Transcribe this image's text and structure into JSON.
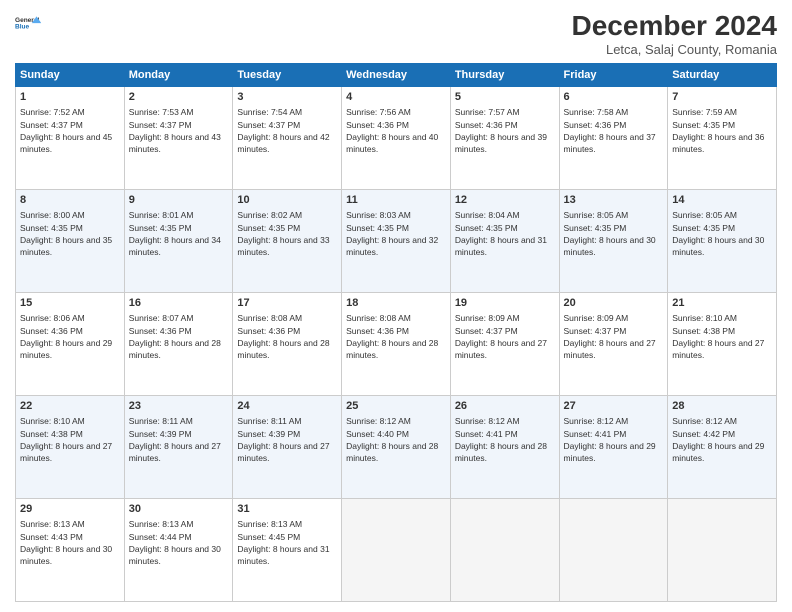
{
  "header": {
    "title": "December 2024",
    "location": "Letca, Salaj County, Romania"
  },
  "days_of_week": [
    "Sunday",
    "Monday",
    "Tuesday",
    "Wednesday",
    "Thursday",
    "Friday",
    "Saturday"
  ],
  "weeks": [
    [
      {
        "day": "1",
        "sunrise": "Sunrise: 7:52 AM",
        "sunset": "Sunset: 4:37 PM",
        "daylight": "Daylight: 8 hours and 45 minutes."
      },
      {
        "day": "2",
        "sunrise": "Sunrise: 7:53 AM",
        "sunset": "Sunset: 4:37 PM",
        "daylight": "Daylight: 8 hours and 43 minutes."
      },
      {
        "day": "3",
        "sunrise": "Sunrise: 7:54 AM",
        "sunset": "Sunset: 4:37 PM",
        "daylight": "Daylight: 8 hours and 42 minutes."
      },
      {
        "day": "4",
        "sunrise": "Sunrise: 7:56 AM",
        "sunset": "Sunset: 4:36 PM",
        "daylight": "Daylight: 8 hours and 40 minutes."
      },
      {
        "day": "5",
        "sunrise": "Sunrise: 7:57 AM",
        "sunset": "Sunset: 4:36 PM",
        "daylight": "Daylight: 8 hours and 39 minutes."
      },
      {
        "day": "6",
        "sunrise": "Sunrise: 7:58 AM",
        "sunset": "Sunset: 4:36 PM",
        "daylight": "Daylight: 8 hours and 37 minutes."
      },
      {
        "day": "7",
        "sunrise": "Sunrise: 7:59 AM",
        "sunset": "Sunset: 4:35 PM",
        "daylight": "Daylight: 8 hours and 36 minutes."
      }
    ],
    [
      {
        "day": "8",
        "sunrise": "Sunrise: 8:00 AM",
        "sunset": "Sunset: 4:35 PM",
        "daylight": "Daylight: 8 hours and 35 minutes."
      },
      {
        "day": "9",
        "sunrise": "Sunrise: 8:01 AM",
        "sunset": "Sunset: 4:35 PM",
        "daylight": "Daylight: 8 hours and 34 minutes."
      },
      {
        "day": "10",
        "sunrise": "Sunrise: 8:02 AM",
        "sunset": "Sunset: 4:35 PM",
        "daylight": "Daylight: 8 hours and 33 minutes."
      },
      {
        "day": "11",
        "sunrise": "Sunrise: 8:03 AM",
        "sunset": "Sunset: 4:35 PM",
        "daylight": "Daylight: 8 hours and 32 minutes."
      },
      {
        "day": "12",
        "sunrise": "Sunrise: 8:04 AM",
        "sunset": "Sunset: 4:35 PM",
        "daylight": "Daylight: 8 hours and 31 minutes."
      },
      {
        "day": "13",
        "sunrise": "Sunrise: 8:05 AM",
        "sunset": "Sunset: 4:35 PM",
        "daylight": "Daylight: 8 hours and 30 minutes."
      },
      {
        "day": "14",
        "sunrise": "Sunrise: 8:05 AM",
        "sunset": "Sunset: 4:35 PM",
        "daylight": "Daylight: 8 hours and 30 minutes."
      }
    ],
    [
      {
        "day": "15",
        "sunrise": "Sunrise: 8:06 AM",
        "sunset": "Sunset: 4:36 PM",
        "daylight": "Daylight: 8 hours and 29 minutes."
      },
      {
        "day": "16",
        "sunrise": "Sunrise: 8:07 AM",
        "sunset": "Sunset: 4:36 PM",
        "daylight": "Daylight: 8 hours and 28 minutes."
      },
      {
        "day": "17",
        "sunrise": "Sunrise: 8:08 AM",
        "sunset": "Sunset: 4:36 PM",
        "daylight": "Daylight: 8 hours and 28 minutes."
      },
      {
        "day": "18",
        "sunrise": "Sunrise: 8:08 AM",
        "sunset": "Sunset: 4:36 PM",
        "daylight": "Daylight: 8 hours and 28 minutes."
      },
      {
        "day": "19",
        "sunrise": "Sunrise: 8:09 AM",
        "sunset": "Sunset: 4:37 PM",
        "daylight": "Daylight: 8 hours and 27 minutes."
      },
      {
        "day": "20",
        "sunrise": "Sunrise: 8:09 AM",
        "sunset": "Sunset: 4:37 PM",
        "daylight": "Daylight: 8 hours and 27 minutes."
      },
      {
        "day": "21",
        "sunrise": "Sunrise: 8:10 AM",
        "sunset": "Sunset: 4:38 PM",
        "daylight": "Daylight: 8 hours and 27 minutes."
      }
    ],
    [
      {
        "day": "22",
        "sunrise": "Sunrise: 8:10 AM",
        "sunset": "Sunset: 4:38 PM",
        "daylight": "Daylight: 8 hours and 27 minutes."
      },
      {
        "day": "23",
        "sunrise": "Sunrise: 8:11 AM",
        "sunset": "Sunset: 4:39 PM",
        "daylight": "Daylight: 8 hours and 27 minutes."
      },
      {
        "day": "24",
        "sunrise": "Sunrise: 8:11 AM",
        "sunset": "Sunset: 4:39 PM",
        "daylight": "Daylight: 8 hours and 27 minutes."
      },
      {
        "day": "25",
        "sunrise": "Sunrise: 8:12 AM",
        "sunset": "Sunset: 4:40 PM",
        "daylight": "Daylight: 8 hours and 28 minutes."
      },
      {
        "day": "26",
        "sunrise": "Sunrise: 8:12 AM",
        "sunset": "Sunset: 4:41 PM",
        "daylight": "Daylight: 8 hours and 28 minutes."
      },
      {
        "day": "27",
        "sunrise": "Sunrise: 8:12 AM",
        "sunset": "Sunset: 4:41 PM",
        "daylight": "Daylight: 8 hours and 29 minutes."
      },
      {
        "day": "28",
        "sunrise": "Sunrise: 8:12 AM",
        "sunset": "Sunset: 4:42 PM",
        "daylight": "Daylight: 8 hours and 29 minutes."
      }
    ],
    [
      {
        "day": "29",
        "sunrise": "Sunrise: 8:13 AM",
        "sunset": "Sunset: 4:43 PM",
        "daylight": "Daylight: 8 hours and 30 minutes."
      },
      {
        "day": "30",
        "sunrise": "Sunrise: 8:13 AM",
        "sunset": "Sunset: 4:44 PM",
        "daylight": "Daylight: 8 hours and 30 minutes."
      },
      {
        "day": "31",
        "sunrise": "Sunrise: 8:13 AM",
        "sunset": "Sunset: 4:45 PM",
        "daylight": "Daylight: 8 hours and 31 minutes."
      },
      null,
      null,
      null,
      null
    ]
  ]
}
